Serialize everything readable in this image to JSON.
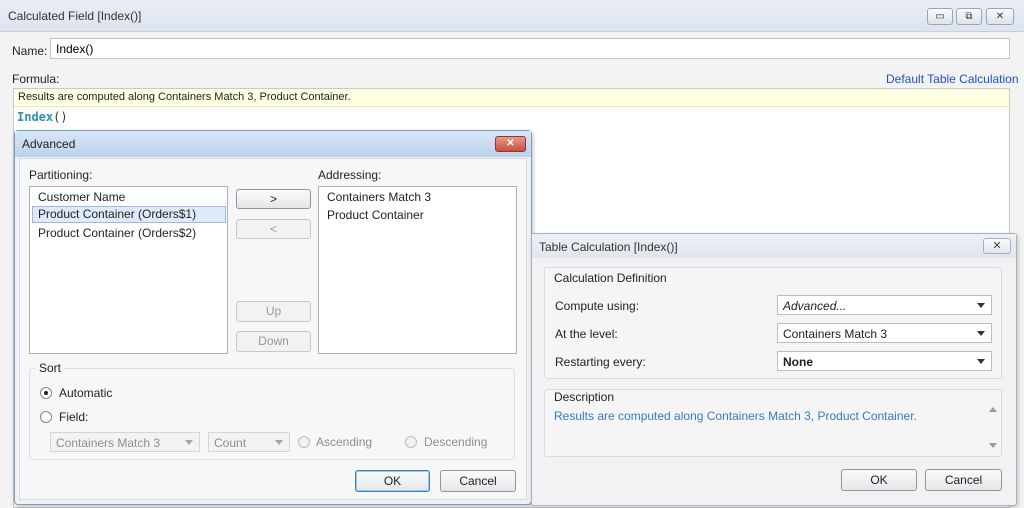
{
  "main_window": {
    "title": "Calculated Field [Index()]",
    "controls": {
      "minimize": "▭",
      "maximize": "⧉",
      "close": "✕"
    },
    "name_label": "Name:",
    "name_value": "Index()",
    "formula_label": "Formula:",
    "default_tc_link": "Default Table Calculation",
    "formula_hint": "Results are computed along Containers Match 3, Product Container.",
    "formula_fn": "Index",
    "formula_parens": "()"
  },
  "advanced_dialog": {
    "title": "Advanced",
    "partitioning_label": "Partitioning:",
    "addressing_label": "Addressing:",
    "partitioning_items": [
      "Customer Name",
      "Product Container (Orders$1)",
      "Product Container (Orders$2)"
    ],
    "addressing_items": [
      "Containers Match 3",
      "Product Container"
    ],
    "move_right": ">",
    "move_left": "<",
    "up": "Up",
    "down": "Down",
    "sort_label": "Sort",
    "automatic_label": "Automatic",
    "field_label": "Field:",
    "field_select": "Containers Match 3",
    "agg_select": "Count",
    "ascending_label": "Ascending",
    "descending_label": "Descending",
    "ok": "OK",
    "cancel": "Cancel"
  },
  "table_calc_dialog": {
    "title": "Table Calculation [Index()]",
    "calc_def_label": "Calculation Definition",
    "compute_using_label": "Compute using:",
    "compute_using_value": "Advanced...",
    "at_level_label": "At the level:",
    "at_level_value": "Containers Match 3",
    "restarting_label": "Restarting every:",
    "restarting_value": "None",
    "description_label": "Description",
    "description_text": "Results are computed along Containers Match 3, Product Container.",
    "ok": "OK",
    "cancel": "Cancel"
  }
}
